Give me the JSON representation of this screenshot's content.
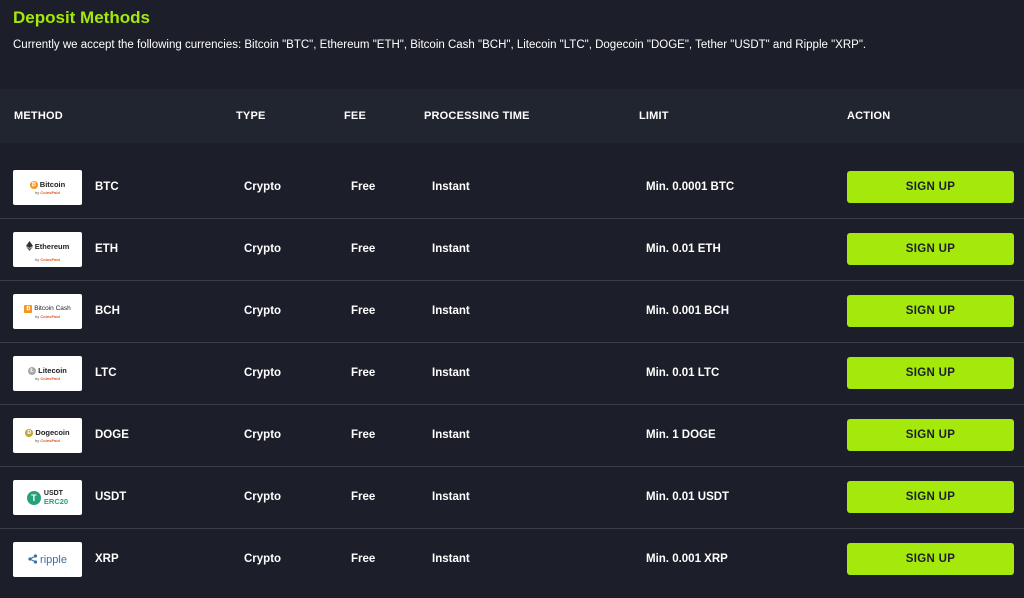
{
  "page": {
    "title": "Deposit Methods",
    "intro": "Currently we accept the following currencies: Bitcoin \"BTC\", Ethereum \"ETH\", Bitcoin Cash \"BCH\", Litecoin \"LTC\", Dogecoin \"DOGE\", Tether \"USDT\" and Ripple \"XRP\"."
  },
  "colors": {
    "accent": "#a4e80c",
    "background": "#1c1f29",
    "header_bg": "#212530",
    "divider": "#3a3e4a"
  },
  "table": {
    "headers": {
      "method": "METHOD",
      "type": "TYPE",
      "fee": "FEE",
      "processing": "PROCESSING TIME",
      "limit": "LIMIT",
      "action": "ACTION"
    },
    "rows": [
      {
        "logo_name": "Bitcoin",
        "logo_by": "by",
        "logo_brand": "CoinsPaid",
        "coin_icon": "bitcoin-icon",
        "symbol": "BTC",
        "type": "Crypto",
        "fee": "Free",
        "processing": "Instant",
        "limit": "Min. 0.0001 BTC",
        "action": "SIGN UP"
      },
      {
        "logo_name": "Ethereum",
        "logo_by": "by",
        "logo_brand": "CoinsPaid",
        "coin_icon": "ethereum-icon",
        "symbol": "ETH",
        "type": "Crypto",
        "fee": "Free",
        "processing": "Instant",
        "limit": "Min. 0.01 ETH",
        "action": "SIGN UP"
      },
      {
        "logo_name": "Bitcoin Cash",
        "logo_by": "by",
        "logo_brand": "CoinsPaid",
        "coin_icon": "bitcoin-cash-icon",
        "symbol": "BCH",
        "type": "Crypto",
        "fee": "Free",
        "processing": "Instant",
        "limit": "Min. 0.001 BCH",
        "action": "SIGN UP"
      },
      {
        "logo_name": "Litecoin",
        "logo_by": "by",
        "logo_brand": "CoinsPaid",
        "coin_icon": "litecoin-icon",
        "symbol": "LTC",
        "type": "Crypto",
        "fee": "Free",
        "processing": "Instant",
        "limit": "Min. 0.01 LTC",
        "action": "SIGN UP"
      },
      {
        "logo_name": "Dogecoin",
        "logo_by": "by",
        "logo_brand": "CoinsPaid",
        "coin_icon": "dogecoin-icon",
        "symbol": "DOGE",
        "type": "Crypto",
        "fee": "Free",
        "processing": "Instant",
        "limit": "Min. 1 DOGE",
        "action": "SIGN UP"
      },
      {
        "logo_line1": "USDT",
        "logo_line2": "ERC20",
        "coin_icon": "tether-icon",
        "symbol": "USDT",
        "type": "Crypto",
        "fee": "Free",
        "processing": "Instant",
        "limit": "Min. 0.01 USDT",
        "action": "SIGN UP"
      },
      {
        "logo_name": "ripple",
        "coin_icon": "ripple-icon",
        "symbol": "XRP",
        "type": "Crypto",
        "fee": "Free",
        "processing": "Instant",
        "limit": "Min. 0.001 XRP",
        "action": "SIGN UP"
      }
    ]
  }
}
